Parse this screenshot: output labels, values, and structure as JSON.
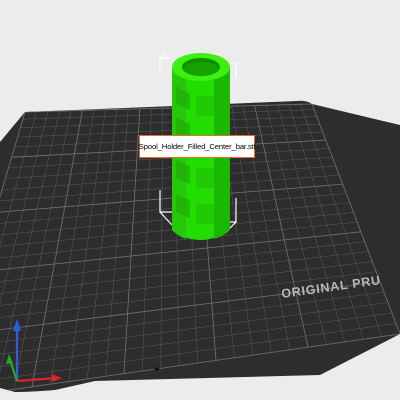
{
  "app": {
    "type": "3d-slicer-viewport"
  },
  "scene": {
    "bed_brand_text": "ORIGINAL PRU",
    "bed_color": "#2d2d2d",
    "background_color": "#ececec",
    "selection_bracket_color": "#ffffff",
    "gridline_color": "#5c5c5c"
  },
  "object": {
    "filename": "Spool_Holder_Filled_Center_bar.stl",
    "color": "#22dd00",
    "selected": true
  },
  "tooltip": {
    "text": "Spool_Holder_Filled_Center_bar.stl",
    "border_color": "#ed6b21"
  },
  "axes": {
    "x_color": "#d8262c",
    "y_color": "#29a62c",
    "z_color": "#2c5fe0",
    "x_icon": "x-axis-arrow-icon",
    "y_icon": "y-axis-arrow-icon",
    "z_icon": "z-axis-arrow-icon"
  }
}
